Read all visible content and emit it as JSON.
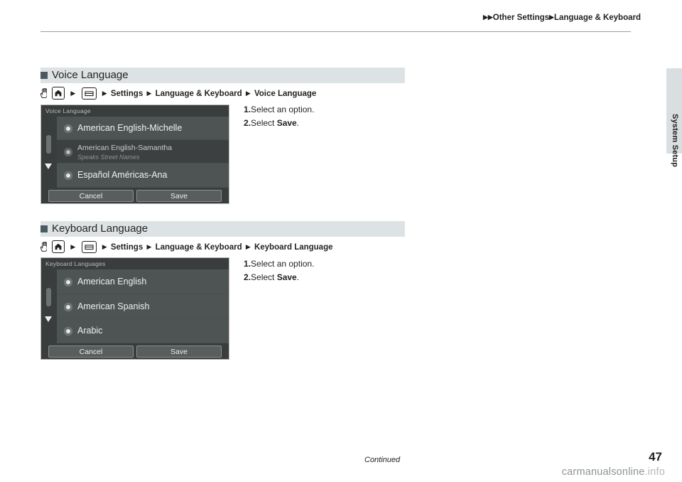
{
  "header": {
    "breadcrumb_1": "Other Settings",
    "breadcrumb_2": "Language & Keyboard",
    "arrow": "▶"
  },
  "side_tab": {
    "label": "System Setup"
  },
  "sections": [
    {
      "id": "voice",
      "title": "Voice Language",
      "path": {
        "settings": "Settings",
        "lang_keyboard": "Language & Keyboard",
        "target": "Voice Language",
        "tri": "▶"
      },
      "screen": {
        "title": "Voice Language",
        "items": [
          {
            "label": "American English-Michelle",
            "sub": ""
          },
          {
            "label": "American English-Samantha",
            "sub": "Speaks Street Names"
          },
          {
            "label": "Español Américas-Ana",
            "sub": ""
          }
        ],
        "cancel": "Cancel",
        "save": "Save"
      },
      "steps": [
        {
          "num": "1.",
          "text": "Select an option.",
          "bold": ""
        },
        {
          "num": "2.",
          "text": "Select ",
          "bold": "Save",
          "tail": "."
        }
      ]
    },
    {
      "id": "keyboard",
      "title": "Keyboard Language",
      "path": {
        "settings": "Settings",
        "lang_keyboard": "Language & Keyboard",
        "target": "Keyboard Language",
        "tri": "▶"
      },
      "screen": {
        "title": "Keyboard Languages",
        "items": [
          {
            "label": "American English",
            "sub": ""
          },
          {
            "label": "American Spanish",
            "sub": ""
          },
          {
            "label": "Arabic",
            "sub": ""
          }
        ],
        "cancel": "Cancel",
        "save": "Save"
      },
      "steps": [
        {
          "num": "1.",
          "text": "Select an option.",
          "bold": ""
        },
        {
          "num": "2.",
          "text": "Select ",
          "bold": "Save",
          "tail": "."
        }
      ]
    }
  ],
  "footer": {
    "continued": "Continued",
    "page": "47",
    "watermark_main": "carmanualsonline",
    "watermark_dim": ".info"
  }
}
